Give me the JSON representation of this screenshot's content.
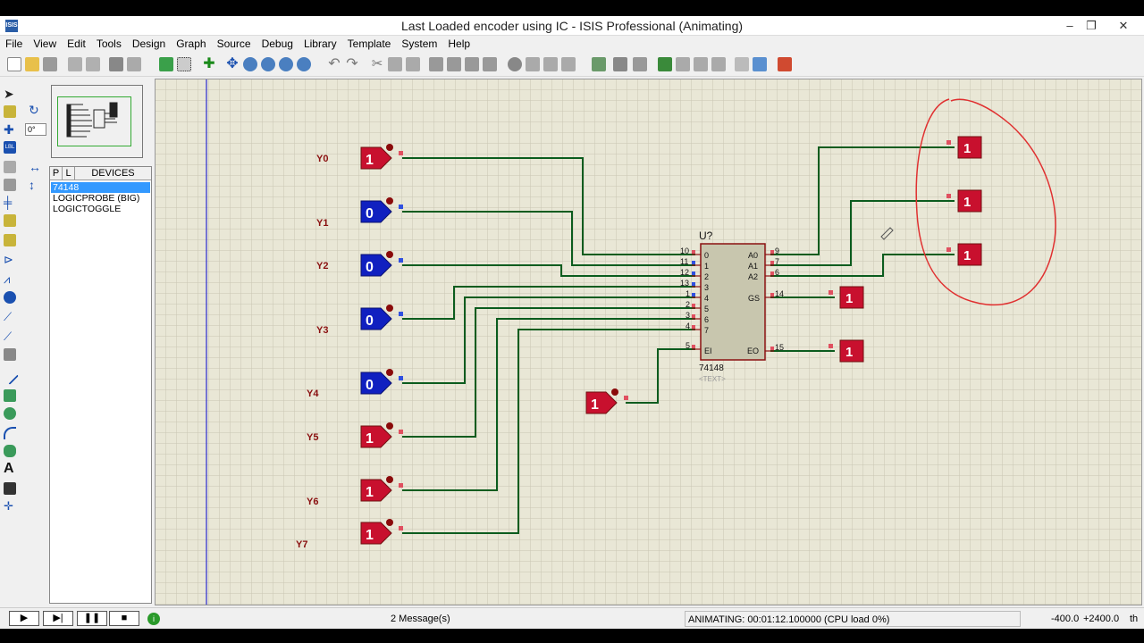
{
  "window": {
    "title": "Last Loaded encoder using IC - ISIS Professional (Animating)",
    "app_icon": "ISIS",
    "controls": [
      "–",
      "❐",
      "✕"
    ]
  },
  "menu": [
    "File",
    "View",
    "Edit",
    "Tools",
    "Design",
    "Graph",
    "Source",
    "Debug",
    "Library",
    "Template",
    "System",
    "Help"
  ],
  "orientation": {
    "angle": "0°"
  },
  "device_panel": {
    "mode_p": "P",
    "mode_l": "L",
    "header": "DEVICES",
    "items": [
      "74148",
      "LOGICPROBE (BIG)",
      "LOGICTOGGLE"
    ],
    "selected_index": 0
  },
  "schematic": {
    "input_labels": [
      "Y0",
      "Y1",
      "Y2",
      "Y3",
      "Y4",
      "Y5",
      "Y6",
      "Y7"
    ],
    "toggle_states": [
      "1",
      "0",
      "0",
      "0",
      "0",
      "1",
      "1",
      "1"
    ],
    "enable_toggle": "1",
    "ic": {
      "ref": "U?",
      "part": "74148",
      "text": "<TEXT>",
      "left_pin_numbers": [
        "10",
        "11",
        "12",
        "13",
        "1",
        "2",
        "3",
        "4",
        "5"
      ],
      "left_pin_names": [
        "0",
        "1",
        "2",
        "3",
        "4",
        "5",
        "6",
        "7",
        "EI"
      ],
      "right_pin_numbers": [
        "9",
        "7",
        "6",
        "14",
        "15"
      ],
      "right_pin_names": [
        "A0",
        "A1",
        "A2",
        "GS",
        "EO"
      ]
    },
    "output_probes": {
      "A0": "1",
      "A1": "1",
      "A2": "1",
      "GS": "1",
      "EO": "1"
    },
    "colors": {
      "logic_high": "#c8102e",
      "logic_low": "#1020c0",
      "wire": "#0b5c1e",
      "annotation": "#e03030",
      "grid": "#c9c6b3",
      "grid_bg": "#e9e7d6"
    }
  },
  "status": {
    "play": "▶",
    "step": "▶|",
    "pause": "❚❚",
    "stop": "■",
    "messages": "2 Message(s)",
    "sim_status": "ANIMATING: 00:01:12.100000 (CPU load 0%)",
    "x_coord": "-400.0",
    "y_coord": "+2400.0",
    "units": "th"
  }
}
